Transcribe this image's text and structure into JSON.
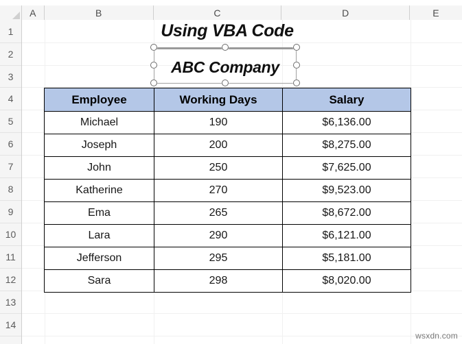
{
  "app": {
    "type": "spreadsheet",
    "watermark": "wsxdn.com"
  },
  "grid": {
    "column_headers": [
      "A",
      "B",
      "C",
      "D",
      "E"
    ],
    "row_headers": [
      "1",
      "2",
      "3",
      "4",
      "5",
      "6",
      "7",
      "8",
      "9",
      "10",
      "11",
      "12",
      "13",
      "14"
    ],
    "header_fill": "#b4c7e7",
    "gridline_color": "#f0f0f0",
    "border_color": "#000000"
  },
  "sheet": {
    "title": "Using VBA Code"
  },
  "textbox": {
    "text": "ABC Company",
    "selected": true,
    "handle_count": 8,
    "handles": [
      "top-left",
      "top-center",
      "top-right",
      "middle-left",
      "middle-right",
      "bottom-left",
      "bottom-center",
      "bottom-right"
    ]
  },
  "table": {
    "headers": [
      "Employee",
      "Working Days",
      "Salary"
    ],
    "rows": [
      {
        "employee": "Michael",
        "working_days": "190",
        "salary": "$6,136.00"
      },
      {
        "employee": "Joseph",
        "working_days": "200",
        "salary": "$8,275.00"
      },
      {
        "employee": "John",
        "working_days": "250",
        "salary": "$7,625.00"
      },
      {
        "employee": "Katherine",
        "working_days": "270",
        "salary": "$9,523.00"
      },
      {
        "employee": "Ema",
        "working_days": "265",
        "salary": "$8,672.00"
      },
      {
        "employee": "Lara",
        "working_days": "290",
        "salary": "$6,121.00"
      },
      {
        "employee": "Jefferson",
        "working_days": "295",
        "salary": "$5,181.00"
      },
      {
        "employee": "Sara",
        "working_days": "298",
        "salary": "$8,020.00"
      }
    ]
  }
}
